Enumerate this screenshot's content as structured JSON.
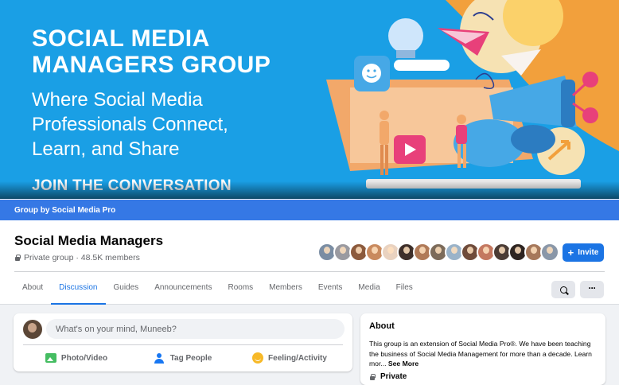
{
  "cover": {
    "title": "SOCIAL MEDIA\nMANAGERS GROUP",
    "subtitle": "Where Social Media\nProfessionals Connect,\nLearn, and Share",
    "cta": "JOIN THE CONVERSATION"
  },
  "group_bar": {
    "label": "Group by Social Media Pro"
  },
  "header": {
    "name": "Social Media Managers",
    "meta": "Private group · 48.5K members",
    "invite_label": "Invite",
    "member_avatar_colors": [
      "#7a8da3",
      "#9a9aa0",
      "#8c5a3c",
      "#c98a5e",
      "#e9d2c0",
      "#3e2f2a",
      "#b07a58",
      "#7c6b5a",
      "#9ab3c9",
      "#6f4b3a",
      "#c47860",
      "#4b3c35",
      "#2e2421",
      "#a6785b",
      "#8a97a8"
    ]
  },
  "tabs": [
    {
      "label": "About",
      "active": false
    },
    {
      "label": "Discussion",
      "active": true
    },
    {
      "label": "Guides",
      "active": false
    },
    {
      "label": "Announcements",
      "active": false
    },
    {
      "label": "Rooms",
      "active": false
    },
    {
      "label": "Members",
      "active": false
    },
    {
      "label": "Events",
      "active": false
    },
    {
      "label": "Media",
      "active": false
    },
    {
      "label": "Files",
      "active": false
    }
  ],
  "icons": {
    "search": "search-icon",
    "more": "more-icon"
  },
  "composer": {
    "placeholder": "What's on your mind, Muneeb?",
    "actions": [
      "Photo/Video",
      "Tag People",
      "Feeling/Activity"
    ]
  },
  "about": {
    "title": "About",
    "text": "This group is an extension of Social Media Pro®. We have been teaching the business of Social Media Management for more than a decade. Learn mor...",
    "see_more": "See More",
    "privacy": "Private"
  },
  "colors": {
    "brand_blue": "#1b74e4",
    "cover_blue": "#1a9fe5",
    "group_bar": "#3578e5"
  }
}
